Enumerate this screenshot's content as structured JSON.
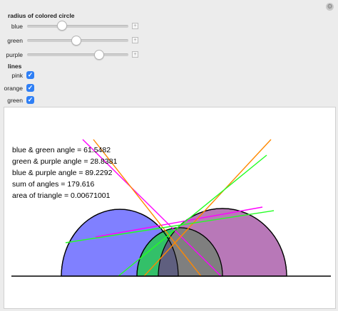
{
  "controls": {
    "gear_glyph": "⚙",
    "radius_title": "radius of colored circle",
    "sliders": [
      {
        "label": "blue",
        "value": 0.33
      },
      {
        "label": "green",
        "value": 0.48
      },
      {
        "label": "purple",
        "value": 0.64
      }
    ],
    "lines_title": "lines",
    "checkboxes": [
      {
        "label": "pink",
        "checked": true
      },
      {
        "label": "orange",
        "checked": true
      },
      {
        "label": "green",
        "checked": true
      }
    ]
  },
  "readouts": {
    "blue_green": "blue & green angle = 61.5482",
    "green_purple": "green & purple angle = 28.8381",
    "blue_purple": "blue & purple angle = 89.2292",
    "sum": "sum of angles = 179.616",
    "area": "area of triangle = 0.00671001"
  },
  "colors": {
    "blue_circle": "#8080ff",
    "green_circle": "#33c069",
    "purple_circle": "#b878b8",
    "overlap": "#7f7f7f",
    "center_overlap": "#5f5f7f",
    "pink_line": "#ff00ff",
    "orange_line": "#ff8800",
    "green_line": "#22ff22",
    "accent": "#2f7ff5"
  }
}
